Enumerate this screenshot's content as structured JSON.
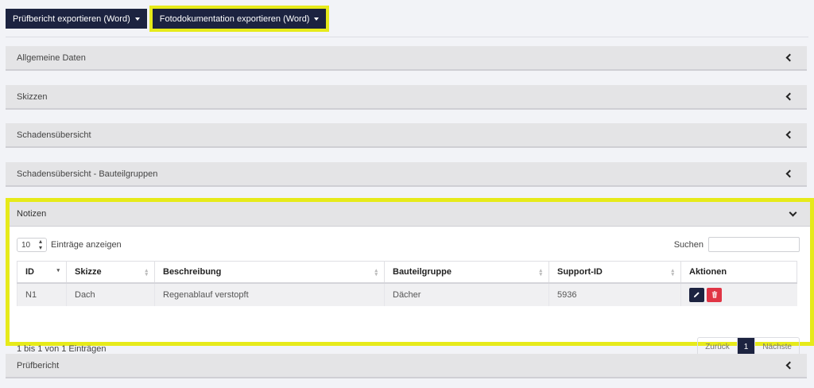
{
  "toolbar": {
    "export_report": "Prüfbericht exportieren (Word)",
    "export_photos": "Fotodokumentation exportieren (Word)"
  },
  "panels": [
    {
      "title": "Allgemeine Daten"
    },
    {
      "title": "Skizzen"
    },
    {
      "title": "Schadensübersicht"
    },
    {
      "title": "Schadensübersicht - Bauteilgruppen"
    },
    {
      "title": "Prüfbericht"
    }
  ],
  "notes": {
    "title": "Notizen",
    "length_value": "10",
    "length_label": "Einträge anzeigen",
    "search_label": "Suchen",
    "search_value": "",
    "columns": [
      "ID",
      "Skizze",
      "Beschreibung",
      "Bauteilgruppe",
      "Support-ID",
      "Aktionen"
    ],
    "rows": [
      {
        "id": "N1",
        "sketch": "Dach",
        "description": "Regenablauf verstopft",
        "group": "Dächer",
        "support_id": "5936"
      }
    ],
    "info": "1 bis 1 von 1 Einträgen",
    "pager": {
      "prev": "Zurück",
      "current": "1",
      "next": "Nächste"
    }
  },
  "icons": [
    "caret-down-icon",
    "chevron-left-icon",
    "chevron-down-icon",
    "pencil-icon",
    "trash-icon",
    "sort-icon"
  ],
  "colors": {
    "primary": "#1c2340",
    "danger": "#e03545",
    "highlight": "#e6ea1a"
  }
}
